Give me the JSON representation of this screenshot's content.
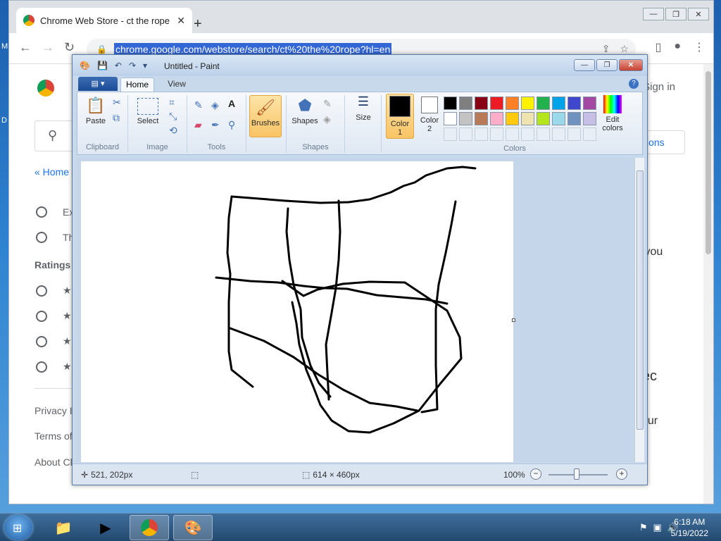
{
  "desktop": {
    "edge_letters": [
      "M",
      "D"
    ]
  },
  "chrome": {
    "tab_title": "Chrome Web Store - ct the rope",
    "tab_close": "✕",
    "new_tab": "+",
    "window_buttons": [
      "—",
      "❐",
      "✕"
    ],
    "url": "chrome.google.com/webstore/search/ct%20the%20rope?hl=en",
    "page": {
      "sign_in": "Sign in",
      "home_link": "« Home",
      "filters": [
        "Ex",
        "Th"
      ],
      "ratings_heading": "Ratings",
      "rating_rows": [
        "★",
        "★",
        "★",
        "★"
      ],
      "footer_links": [
        "Privacy I",
        "Terms of",
        "About Cl"
      ],
      "right_button": "ions",
      "right_snippets": [
        "s you",
        "llec",
        "your"
      ]
    }
  },
  "paint": {
    "title": "Untitled - Paint",
    "window_buttons": [
      "—",
      "❐",
      "✕"
    ],
    "tabs": {
      "file": "▤ ▾",
      "home": "Home",
      "view": "View"
    },
    "ribbon": {
      "clipboard": {
        "paste": "Paste",
        "label": "Clipboard"
      },
      "image": {
        "select": "Select",
        "label": "Image"
      },
      "tools": {
        "label": "Tools"
      },
      "brushes": "Brushes",
      "shapes": {
        "button": "Shapes",
        "label": "Shapes"
      },
      "size": "Size",
      "color1": {
        "line1": "Color",
        "line2": "1"
      },
      "color2": {
        "line1": "Color",
        "line2": "2"
      },
      "edit_colors": {
        "line1": "Edit",
        "line2": "colors"
      },
      "colors_label": "Colors"
    },
    "palette": [
      "#000000",
      "#7f7f7f",
      "#880015",
      "#ed1c24",
      "#ff7f27",
      "#fff200",
      "#22b14c",
      "#00a2e8",
      "#3f48cc",
      "#a349a4",
      "#ffffff",
      "#c3c3c3",
      "#b97a57",
      "#ffaec9",
      "#ffc90e",
      "#efe4b0",
      "#b5e61d",
      "#99d9ea",
      "#7092be",
      "#c8bfe7"
    ],
    "status": {
      "cursor_pos": "521, 202px",
      "canvas_size": "614 × 460px",
      "zoom": "100%"
    }
  },
  "taskbar": {
    "clock_time": "6:18 AM",
    "clock_date": "5/19/2022"
  }
}
